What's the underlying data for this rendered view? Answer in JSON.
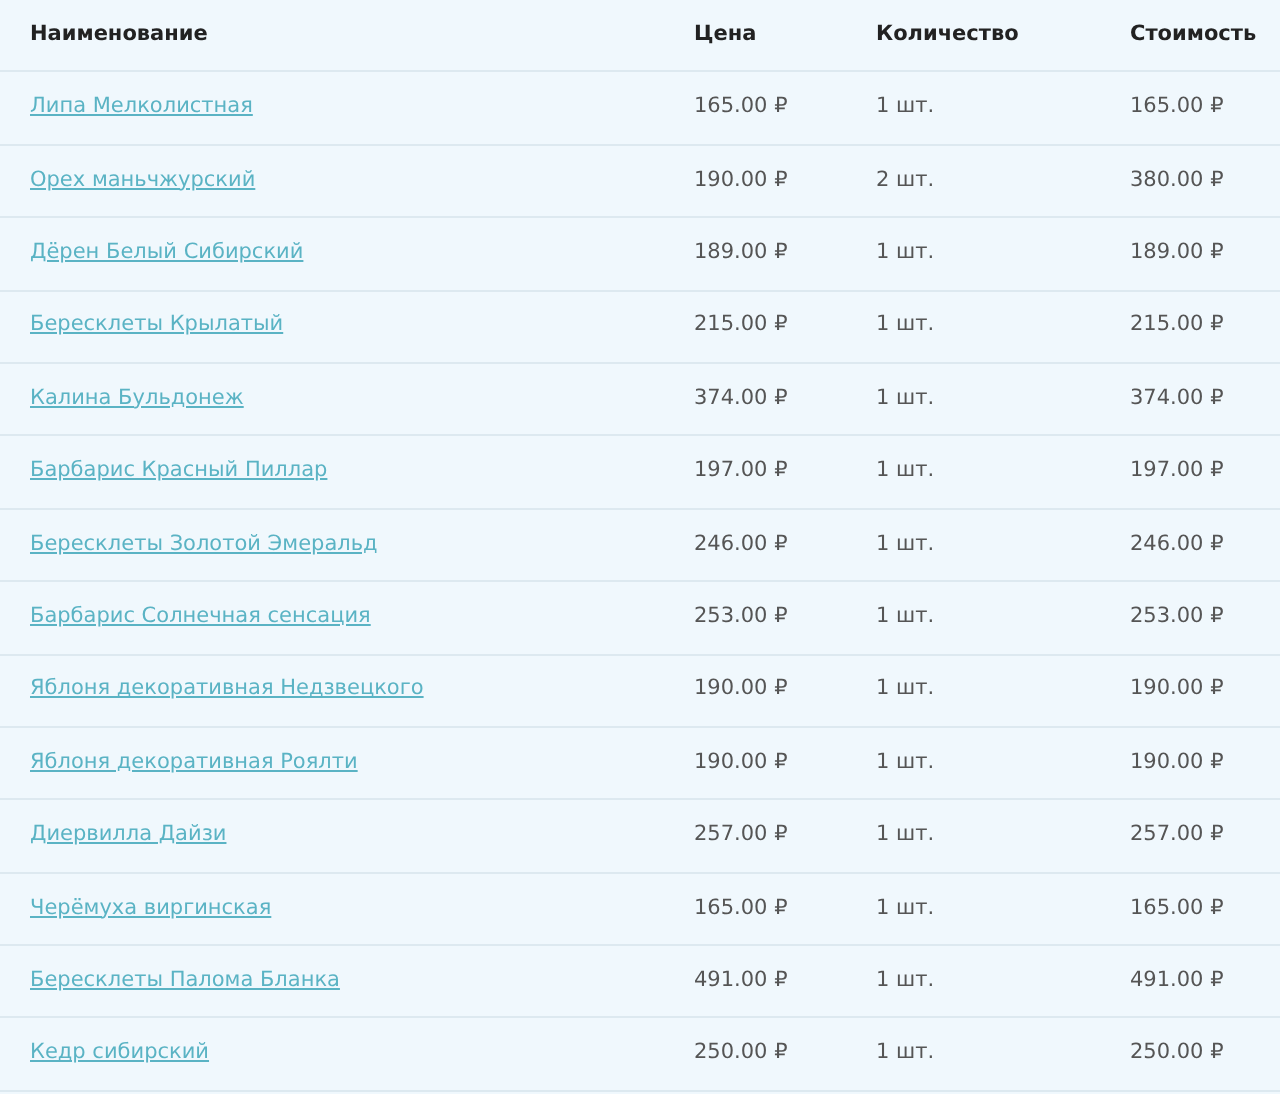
{
  "table": {
    "columns": [
      "Наименование",
      "Цена",
      "Количество",
      "Стоимость"
    ],
    "rows": [
      {
        "name": "Липа Мелколистная",
        "price": "165.00 ₽",
        "qty": "1 шт.",
        "total": "165.00 ₽"
      },
      {
        "name": "Орех маньчжурский",
        "price": "190.00 ₽",
        "qty": "2 шт.",
        "total": "380.00 ₽"
      },
      {
        "name": "Дёрен Белый Сибирский",
        "price": "189.00 ₽",
        "qty": "1 шт.",
        "total": "189.00 ₽"
      },
      {
        "name": "Бересклеты Крылатый",
        "price": "215.00 ₽",
        "qty": "1 шт.",
        "total": "215.00 ₽"
      },
      {
        "name": "Калина Бульдонеж",
        "price": "374.00 ₽",
        "qty": "1 шт.",
        "total": "374.00 ₽"
      },
      {
        "name": "Барбарис Красный Пиллар",
        "price": "197.00 ₽",
        "qty": "1 шт.",
        "total": "197.00 ₽"
      },
      {
        "name": "Бересклеты Золотой Эмеральд",
        "price": "246.00 ₽",
        "qty": "1 шт.",
        "total": "246.00 ₽"
      },
      {
        "name": "Барбарис Солнечная сенсация",
        "price": "253.00 ₽",
        "qty": "1 шт.",
        "total": "253.00 ₽"
      },
      {
        "name": "Яблоня декоративная Недзвецкого",
        "price": "190.00 ₽",
        "qty": "1 шт.",
        "total": "190.00 ₽"
      },
      {
        "name": "Яблоня декоративная Роялти",
        "price": "190.00 ₽",
        "qty": "1 шт.",
        "total": "190.00 ₽"
      },
      {
        "name": "Диервилла Дайзи",
        "price": "257.00 ₽",
        "qty": "1 шт.",
        "total": "257.00 ₽"
      },
      {
        "name": "Черёмуха виргинская",
        "price": "165.00 ₽",
        "qty": "1 шт.",
        "total": "165.00 ₽"
      },
      {
        "name": "Бересклеты Палома Бланка",
        "price": "491.00 ₽",
        "qty": "1 шт.",
        "total": "491.00 ₽"
      },
      {
        "name": "Кедр сибирский",
        "price": "250.00 ₽",
        "qty": "1 шт.",
        "total": "250.00 ₽"
      }
    ]
  }
}
